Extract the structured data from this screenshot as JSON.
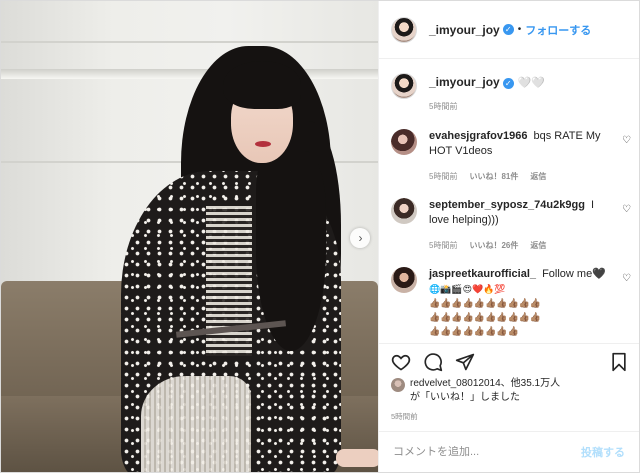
{
  "post": {
    "username": "_imyour_joy",
    "verified_mark": "✓",
    "follow_label": "フォローする",
    "dot": "•",
    "caption_hearts": "🤍🤍",
    "caption_time": "5時間前",
    "next_arrow": "›"
  },
  "comments": [
    {
      "username": "evahesjgrafov1966",
      "text": "bqs RATE My HOT V1deos",
      "time": "5時間前",
      "likes": "いいね！81件",
      "reply": "返信"
    },
    {
      "username": "september_syposz_74u2k9gg",
      "text": "I love helping)))",
      "time": "5時間前",
      "likes": "いいね！26件",
      "reply": "返信"
    },
    {
      "username": "jaspreetkaurofficial_",
      "text": "Follow me🖤",
      "emoji_line1": "🌐📸🎬😍❤️🔥💯",
      "emoji_line2": "👍🏽👍🏽👍🏽👍🏽👍🏽👍🏽👍🏽👍🏽👍🏽👍🏽",
      "emoji_line3": "👍🏽👍🏽👍🏽👍🏽👍🏽👍🏽👍🏽👍🏽👍🏽👍🏽",
      "emoji_line4": "👍🏽👍🏽👍🏽👍🏽👍🏽👍🏽👍🏽👍🏽"
    }
  ],
  "likes_block": {
    "line1": "redvelvet_08012014、他35.1万人",
    "line2": "が「いいね！」しました",
    "time": "5時間前"
  },
  "comment_box": {
    "placeholder": "コメントを追加...",
    "post_label": "投稿する"
  },
  "icons": {
    "like": "heart-icon",
    "comment": "comment-icon",
    "share": "share-icon",
    "save": "bookmark-icon"
  },
  "colors": {
    "accent": "#3897f0",
    "post_disabled": "#b2dffc",
    "meta": "#8e8e8e"
  }
}
